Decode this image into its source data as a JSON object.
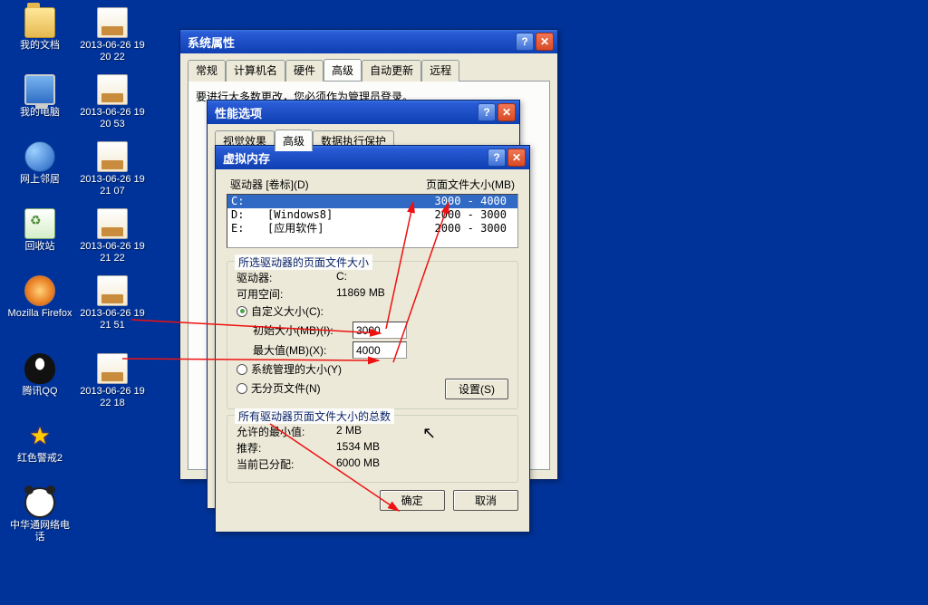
{
  "desktop": {
    "col1": [
      {
        "label": "我的文档"
      },
      {
        "label": "我的电脑"
      },
      {
        "label": "网上邻居"
      },
      {
        "label": "回收站"
      },
      {
        "label": "Mozilla Firefox"
      },
      {
        "label": "腾讯QQ"
      },
      {
        "label": "红色警戒2"
      },
      {
        "label": "中华通网络电话"
      }
    ],
    "col2": [
      {
        "label": "2013-06-26 19 20 22"
      },
      {
        "label": "2013-06-26 19 20 53"
      },
      {
        "label": "2013-06-26 19 21 07"
      },
      {
        "label": "2013-06-26 19 21 22"
      },
      {
        "label": "2013-06-26 19 21 51"
      },
      {
        "label": "2013-06-26 19 22 18"
      }
    ]
  },
  "win_sysprops": {
    "title": "系统属性",
    "tabs": [
      "常规",
      "计算机名",
      "硬件",
      "高级",
      "自动更新",
      "远程"
    ],
    "active_tab": "高级",
    "note": "要进行大多数更改，您必须作为管理员登录。"
  },
  "win_perf": {
    "title": "性能选项",
    "tabs": [
      "视觉效果",
      "高级",
      "数据执行保护"
    ],
    "active_tab": "高级"
  },
  "win_vm": {
    "title": "虚拟内存",
    "drives_header_left": "驱动器 [卷标](D)",
    "drives_header_right": "页面文件大小(MB)",
    "drives": [
      {
        "drive": "C:",
        "label": "",
        "size": "3000 - 4000",
        "selected": true
      },
      {
        "drive": "D:",
        "label": "[Windows8]",
        "size": "2000 - 3000"
      },
      {
        "drive": "E:",
        "label": "[应用软件]",
        "size": "2000 - 3000"
      }
    ],
    "selected_group_title": "所选驱动器的页面文件大小",
    "selected_drive_label": "驱动器:",
    "selected_drive_value": "C:",
    "free_space_label": "可用空间:",
    "free_space_value": "11869 MB",
    "radio_custom": "自定义大小(C):",
    "initial_label": "初始大小(MB)(I):",
    "initial_value": "3000",
    "max_label": "最大值(MB)(X):",
    "max_value": "4000",
    "radio_system": "系统管理的大小(Y)",
    "radio_none": "无分页文件(N)",
    "set_btn": "设置(S)",
    "totals_group_title": "所有驱动器页面文件大小的总数",
    "min_allowed_label": "允许的最小值:",
    "min_allowed_value": "2 MB",
    "recommended_label": "推荐:",
    "recommended_value": "1534 MB",
    "allocated_label": "当前已分配:",
    "allocated_value": "6000 MB",
    "ok_btn": "确定",
    "cancel_btn": "取消"
  }
}
